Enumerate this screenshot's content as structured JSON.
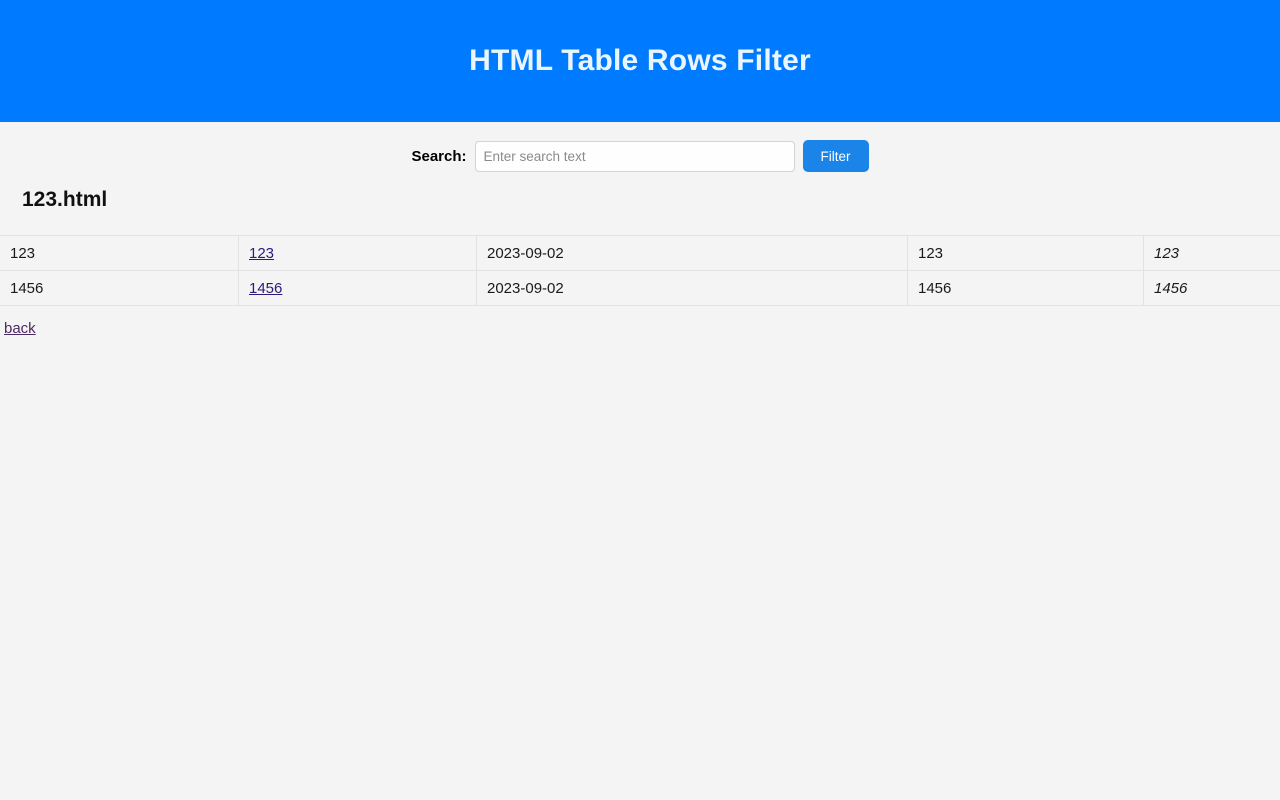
{
  "header": {
    "title": "HTML Table Rows Filter",
    "background_color": "#007bff",
    "text_color": "#eaf6ff"
  },
  "search": {
    "label": "Search:",
    "placeholder": "Enter search text",
    "value": "",
    "filter_button_label": "Filter",
    "filter_button_color": "#1a84e8"
  },
  "page": {
    "file_title": "123.html",
    "background_color": "#f4f4f4"
  },
  "table": {
    "rows": [
      {
        "col_a": "123",
        "col_b_link": "123",
        "col_c": "2023-09-02",
        "col_d": "123",
        "col_e": "123"
      },
      {
        "col_a": "1456",
        "col_b_link": "1456",
        "col_c": "2023-09-02",
        "col_d": "1456",
        "col_e": "1456"
      }
    ]
  },
  "footer": {
    "back_label": "back"
  }
}
